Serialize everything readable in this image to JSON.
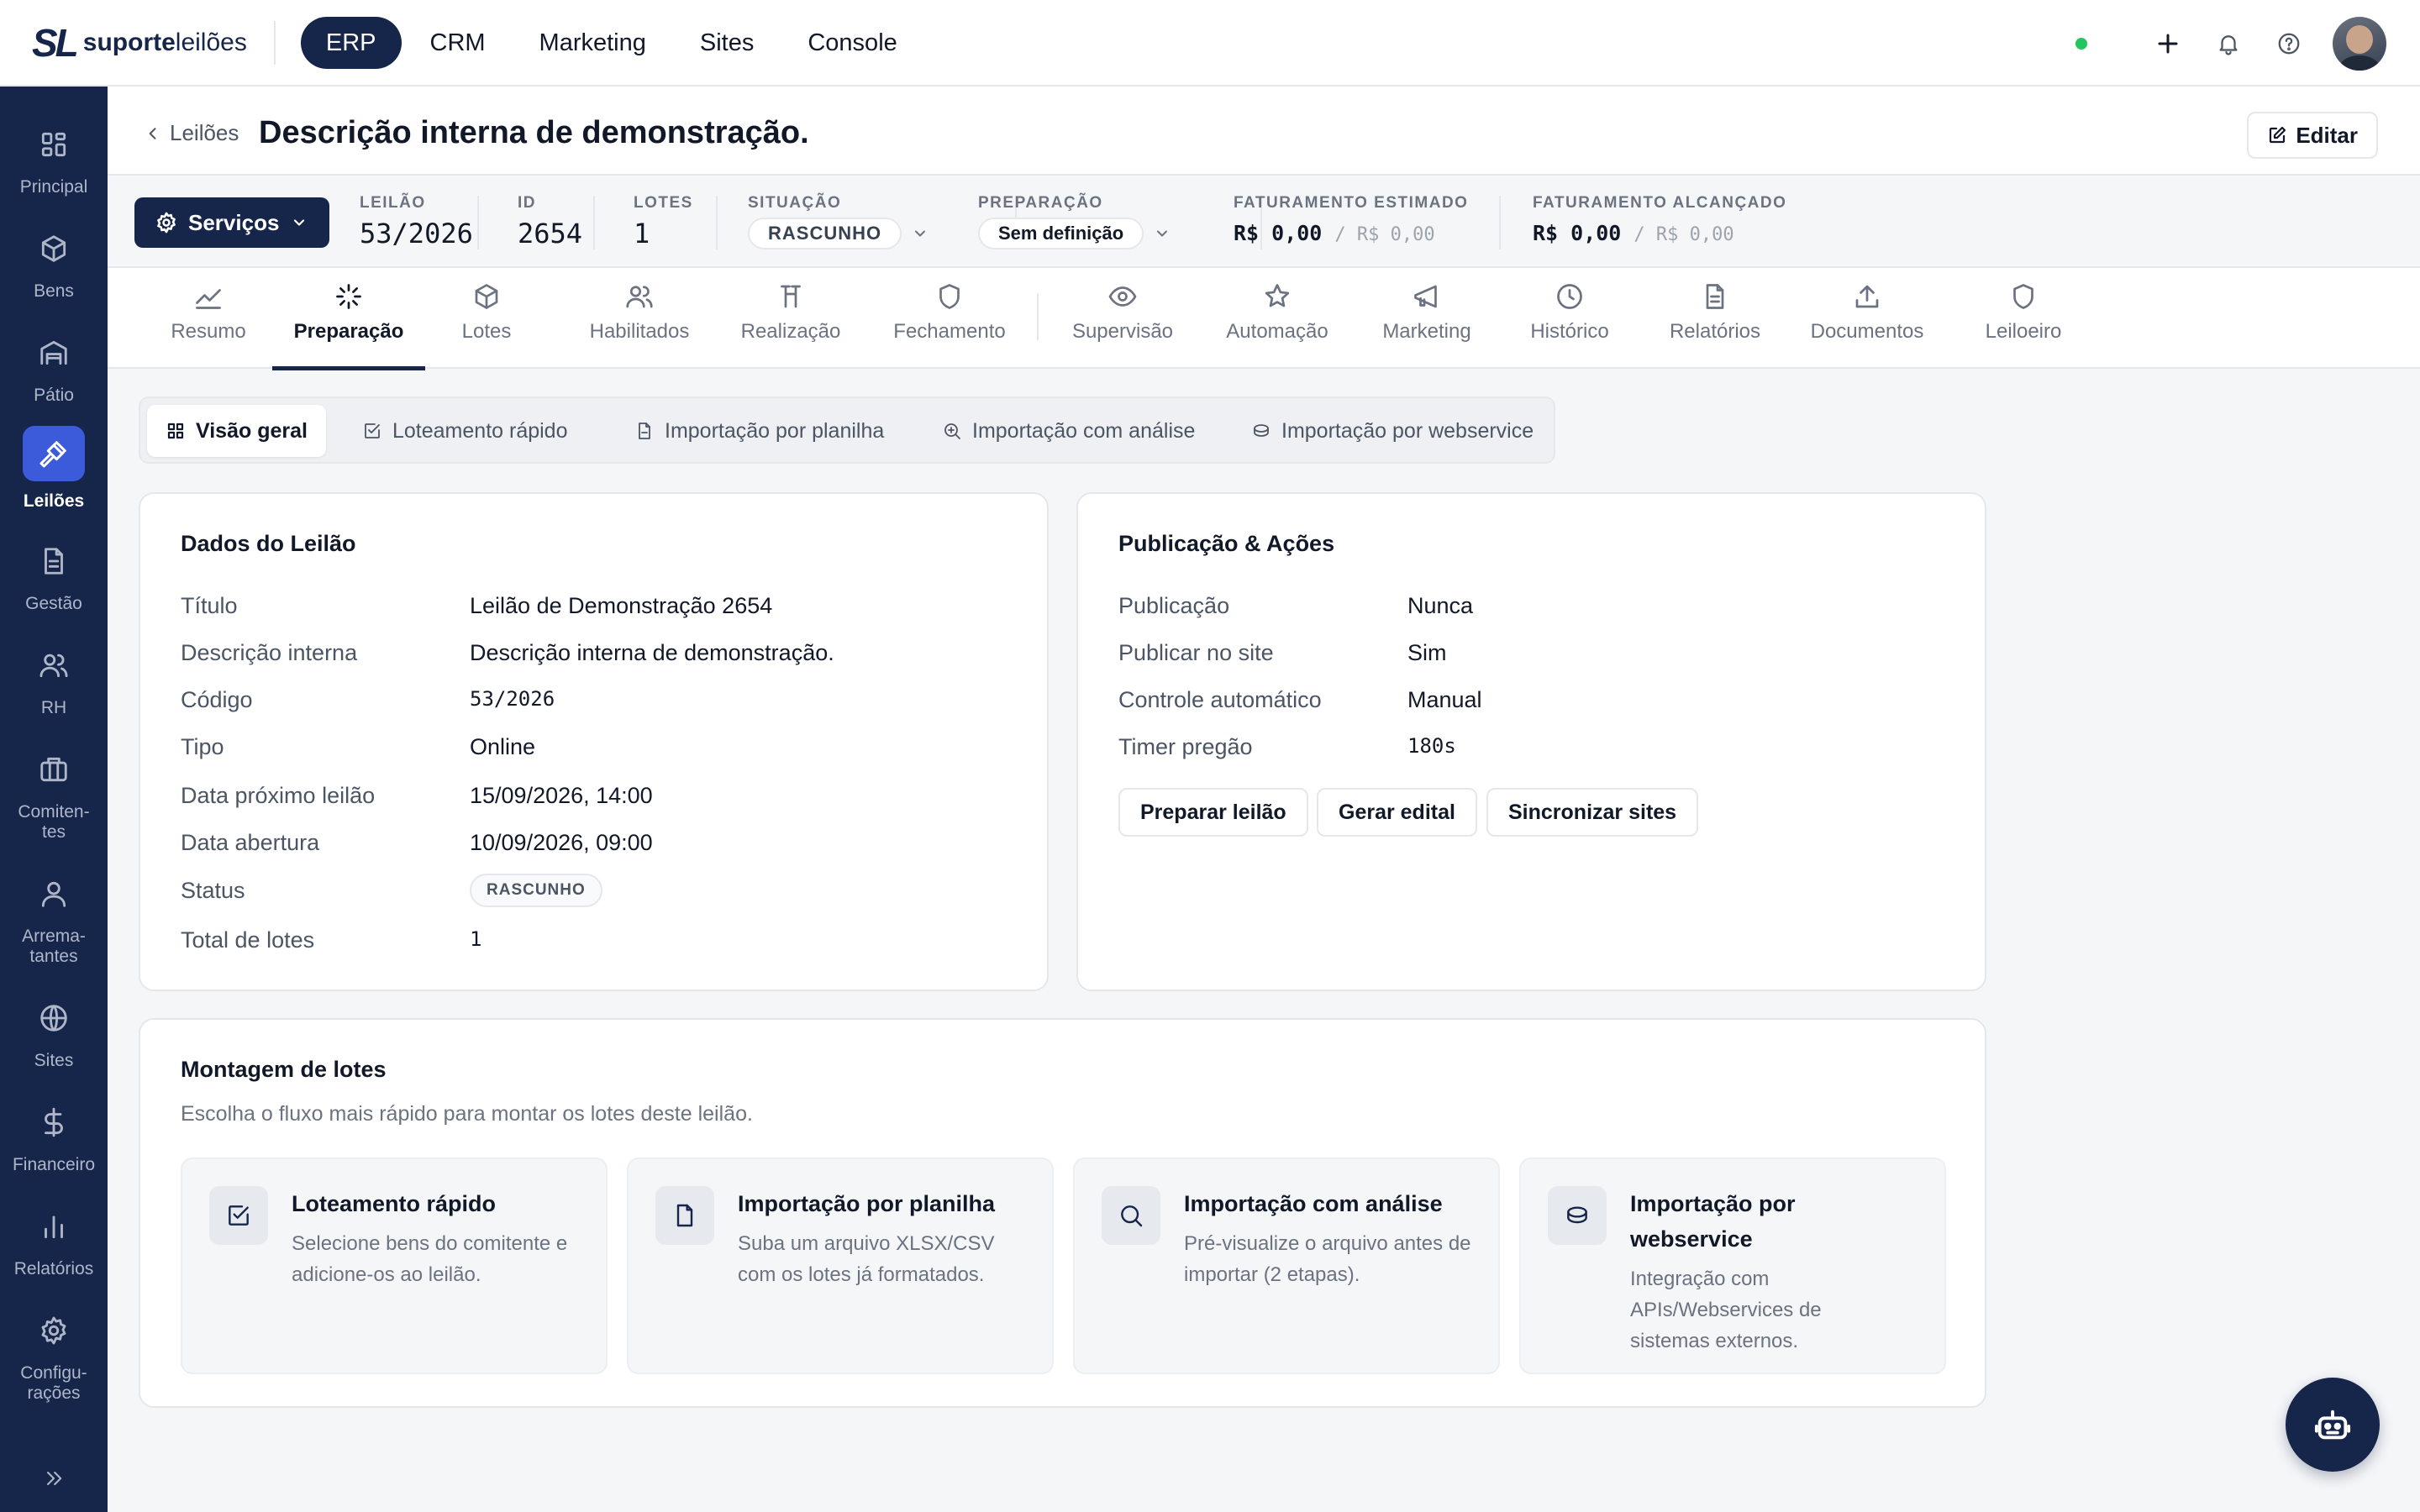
{
  "brand": {
    "mark": "SL",
    "word1": "suporte",
    "word2": "leilões"
  },
  "modules": [
    {
      "label": "ERP"
    },
    {
      "label": "CRM"
    },
    {
      "label": "Marketing"
    },
    {
      "label": "Sites"
    },
    {
      "label": "Console"
    }
  ],
  "sidebar": {
    "items": [
      {
        "label": "Principal",
        "icon": "grid-icon"
      },
      {
        "label": "Bens",
        "icon": "box-icon"
      },
      {
        "label": "Pátio",
        "icon": "warehouse-icon"
      },
      {
        "label": "Leilões",
        "icon": "gavel-icon",
        "active": true
      },
      {
        "label": "Gestão",
        "icon": "document-icon"
      },
      {
        "label": "RH",
        "icon": "users-icon"
      },
      {
        "label": "Comiten-tes",
        "icon": "briefcase-icon"
      },
      {
        "label": "Arrema-tantes",
        "icon": "user-icon"
      },
      {
        "label": "Sites",
        "icon": "globe-icon"
      },
      {
        "label": "Financeiro",
        "icon": "dollar-icon"
      },
      {
        "label": "Relatórios",
        "icon": "bar-chart-icon"
      },
      {
        "label": "Configu-rações",
        "icon": "gear-icon"
      }
    ]
  },
  "header": {
    "breadcrumb": "Leilões",
    "title": "Descrição interna de demonstração.",
    "edit_label": "Editar"
  },
  "stats": {
    "services_label": "Serviços",
    "leilao": {
      "key": "LEILÃO",
      "value": "53/2026"
    },
    "id": {
      "key": "ID",
      "value": "2654"
    },
    "lotes": {
      "key": "LOTES",
      "value": "1"
    },
    "situacao": {
      "key": "SITUAÇÃO",
      "value": "RASCUNHO"
    },
    "preparacao": {
      "key": "PREPARAÇÃO",
      "value": "Sem definição"
    },
    "fat_estimado": {
      "key": "FATURAMENTO ESTIMADO",
      "value": "R$ 0,00",
      "secondary": "/ R$ 0,00"
    },
    "fat_alcancado": {
      "key": "FATURAMENTO ALCANÇADO",
      "value": "R$ 0,00",
      "secondary": "/ R$ 0,00"
    }
  },
  "tabs": [
    {
      "label": "Resumo",
      "icon": "trend-icon"
    },
    {
      "label": "Preparação",
      "icon": "loader-icon",
      "active": true
    },
    {
      "label": "Lotes",
      "icon": "box-icon"
    },
    {
      "label": "Habilitados",
      "icon": "users-icon"
    },
    {
      "label": "Realização",
      "icon": "gavel-icon"
    },
    {
      "label": "Fechamento",
      "icon": "shield-icon"
    },
    {
      "label": "Supervisão",
      "icon": "eye-icon"
    },
    {
      "label": "Automação",
      "icon": "star-icon"
    },
    {
      "label": "Marketing",
      "icon": "megaphone-icon"
    },
    {
      "label": "Histórico",
      "icon": "clock-icon"
    },
    {
      "label": "Relatórios",
      "icon": "file-text-icon"
    },
    {
      "label": "Documentos",
      "icon": "upload-icon"
    },
    {
      "label": "Leiloeiro",
      "icon": "shield-icon"
    }
  ],
  "subtabs": [
    {
      "label": "Visão geral",
      "icon": "grid-icon",
      "active": true
    },
    {
      "label": "Loteamento rápido",
      "icon": "check-square-icon"
    },
    {
      "label": "Importação por planilha",
      "icon": "file-icon"
    },
    {
      "label": "Importação com análise",
      "icon": "zoom-icon"
    },
    {
      "label": "Importação por webservice",
      "icon": "database-icon"
    }
  ],
  "dados": {
    "title": "Dados do Leilão",
    "rows": [
      {
        "k": "Título",
        "v": "Leilão de Demonstração 2654"
      },
      {
        "k": "Descrição interna",
        "v": "Descrição interna de demonstração."
      },
      {
        "k": "Código",
        "v": "53/2026"
      },
      {
        "k": "Tipo",
        "v": "Online"
      },
      {
        "k": "Data próximo leilão",
        "v": "15/09/2026, 14:00"
      },
      {
        "k": "Data abertura",
        "v": "10/09/2026, 09:00"
      },
      {
        "k": "Status",
        "v": "RASCUNHO"
      },
      {
        "k": "Total de lotes",
        "v": "1"
      }
    ]
  },
  "publicacao": {
    "title": "Publicação & Ações",
    "rows": [
      {
        "k": "Publicação",
        "v": "Nunca"
      },
      {
        "k": "Publicar no site",
        "v": "Sim"
      },
      {
        "k": "Controle automático",
        "v": "Manual"
      },
      {
        "k": "Timer pregão",
        "v": "180s"
      }
    ],
    "buttons": [
      "Preparar leilão",
      "Gerar edital",
      "Sincronizar sites"
    ]
  },
  "montagem": {
    "title": "Montagem de lotes",
    "subtitle": "Escolha o fluxo mais rápido para montar os lotes deste leilão.",
    "options": [
      {
        "title": "Loteamento rápido",
        "desc": "Selecione bens do comitente e adicione-os ao leilão.",
        "icon": "check-square-icon"
      },
      {
        "title": "Importação por planilha",
        "desc": "Suba um arquivo XLSX/CSV com os lotes já formatados.",
        "icon": "file-icon"
      },
      {
        "title": "Importação com análise",
        "desc": "Pré-visualize o arquivo antes de importar (2 etapas).",
        "icon": "search-icon"
      },
      {
        "title": "Importação por webservice",
        "desc": "Integração com APIs/Webservices de sistemas externos.",
        "icon": "database-icon"
      }
    ]
  },
  "colors": {
    "navy": "#16254a",
    "accent": "#3b5bdb",
    "online": "#22c55e"
  }
}
